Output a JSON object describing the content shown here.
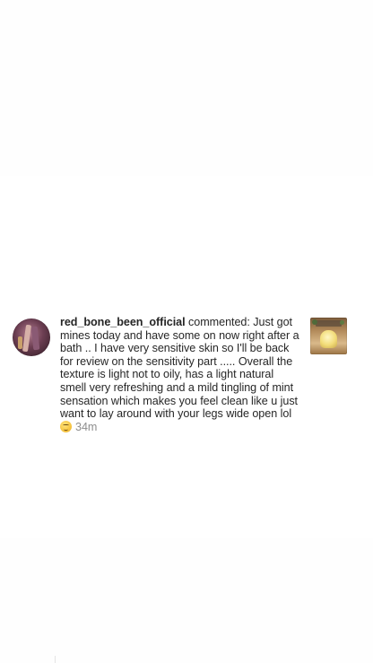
{
  "notification": {
    "username": "red_bone_been_official",
    "action": " commented: ",
    "comment": "Just got mines today and have some on now right after a bath .. I have very sensitive skin so I'll be back for review on the sensitivity part ..... Overall the texture is light not to oily, has a light natural smell very refreshing and a mild tingling of mint sensation which makes you feel clean like u just want to lay around with your legs wide open lol",
    "emoji_icon": "grinning-face-with-sweat-emoji",
    "timestamp": "34m",
    "avatar_icon": "user-avatar",
    "thumbnail_icon": "post-thumbnail"
  }
}
